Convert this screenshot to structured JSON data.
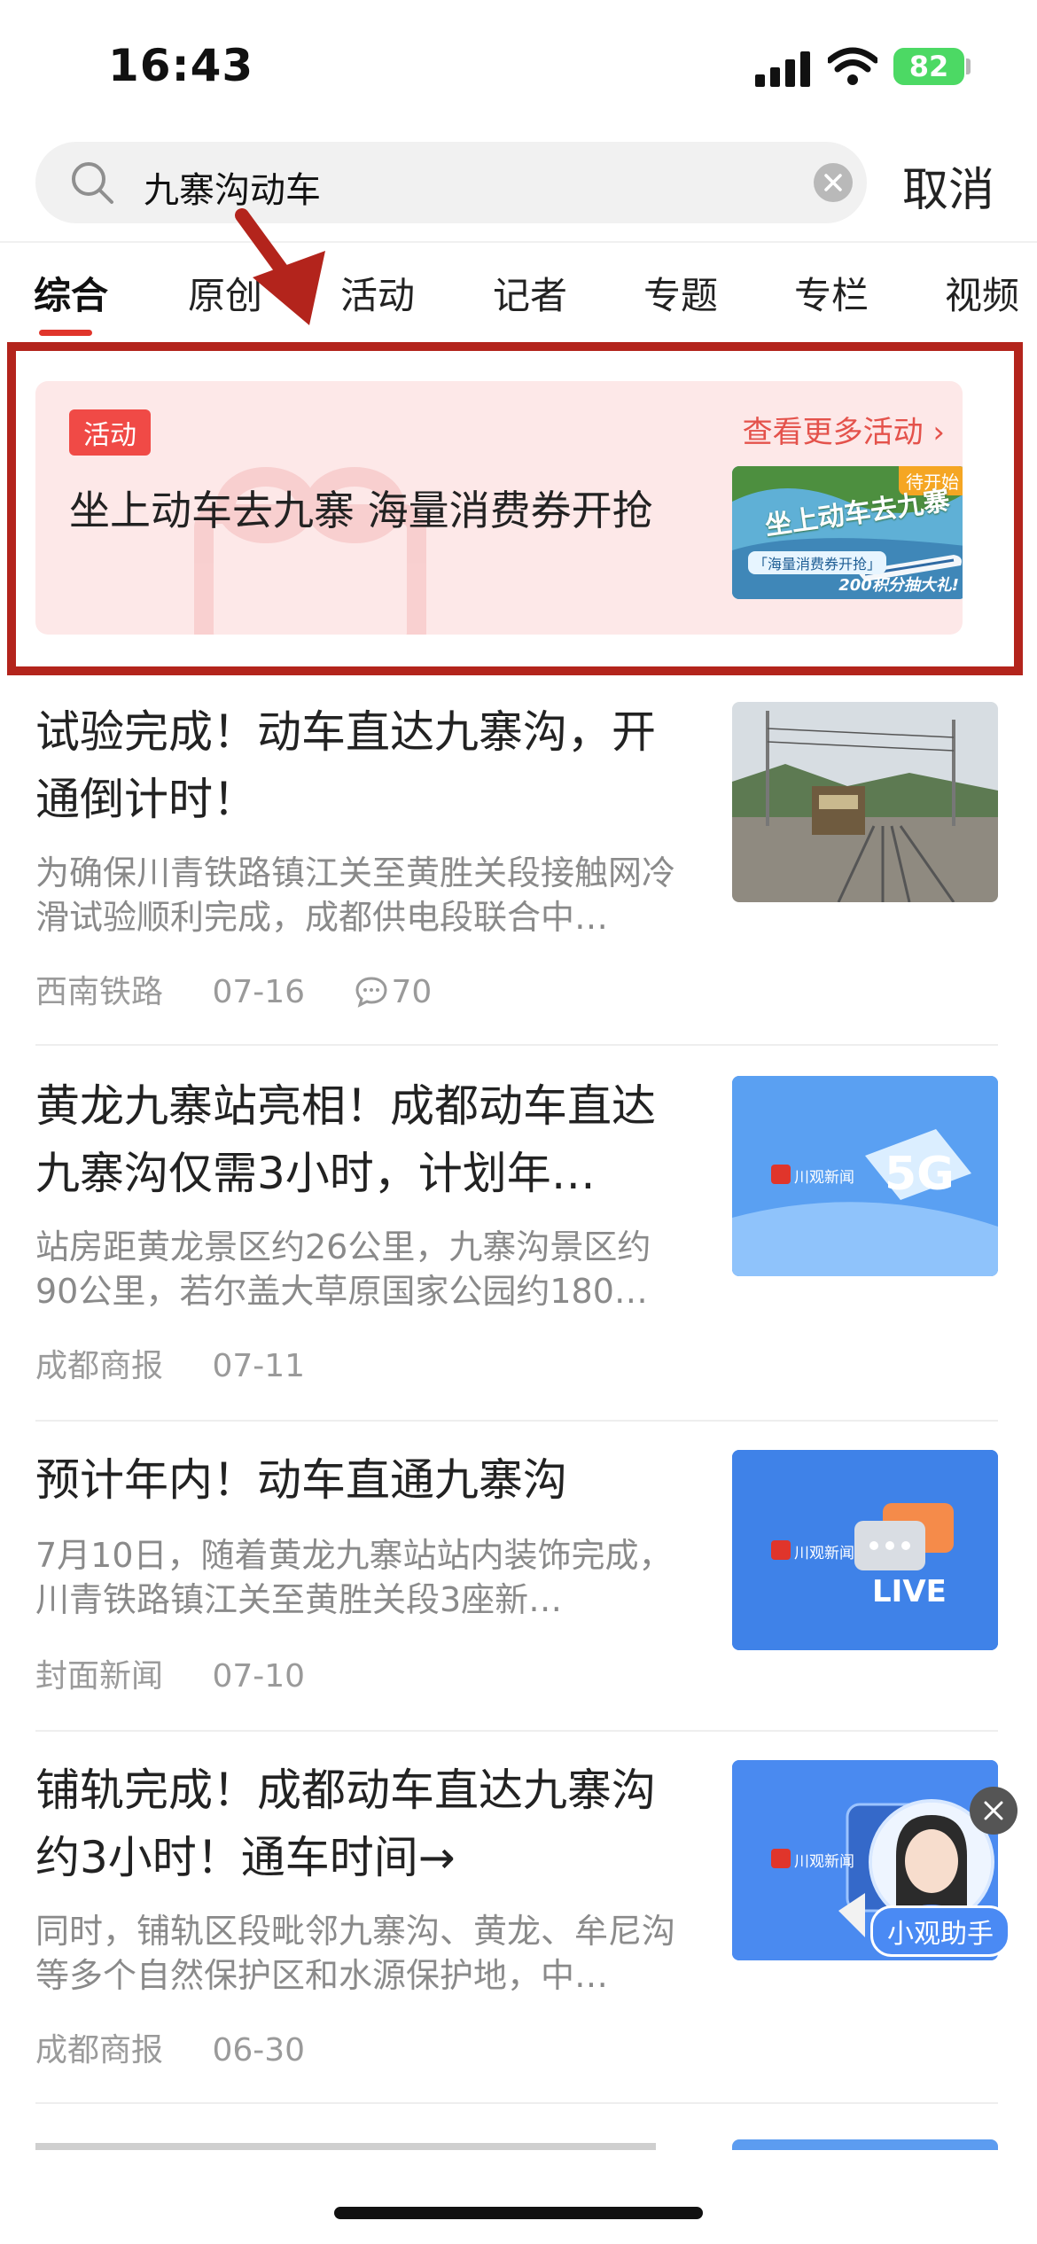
{
  "status_bar": {
    "time": "16:43",
    "battery": "82"
  },
  "search": {
    "query": "九寨沟动车",
    "cancel_label": "取消"
  },
  "tabs": [
    {
      "label": "综合"
    },
    {
      "label": "原创"
    },
    {
      "label": "活动"
    },
    {
      "label": "记者"
    },
    {
      "label": "专题"
    },
    {
      "label": "专栏"
    },
    {
      "label": "视频"
    }
  ],
  "banner": {
    "tag": "活动",
    "more_label": "查看更多活动 ›",
    "title": "坐上动车去九寨  海量消费券开抢",
    "thumb": {
      "badge": "待开始",
      "caption_main": "坐上动车去九寨",
      "caption_sub": "「海量消费券开抢」",
      "caption_bonus": "200积分抽大礼!"
    }
  },
  "news": [
    {
      "title": "试验完成！动车直达九寨沟，开通倒计时！",
      "summary": "为确保川青铁路镇江关至黄胜关段接触网冷滑试验顺利完成，成都供电段联合中…",
      "source": "西南铁路",
      "date": "07-16",
      "comments": "70"
    },
    {
      "title": "黄龙九寨站亮相！成都动车直达九寨沟仅需3小时，计划年…",
      "summary": "站房距黄龙景区约26公里，九寨沟景区约90公里，若尔盖大草原国家公园约180…",
      "source": "成都商报",
      "date": "07-11",
      "thumb_brand": "川观新闻"
    },
    {
      "title": "预计年内！动车直通九寨沟",
      "summary": "7月10日，随着黄龙九寨站站内装饰完成，川青铁路镇江关至黄胜关段3座新…",
      "source": "封面新闻",
      "date": "07-10",
      "thumb_brand": "川观新闻",
      "thumb_label": "LIVE"
    },
    {
      "title": "铺轨完成！成都动车直达九寨沟约3小时！通车时间→",
      "summary": "同时，铺轨区段毗邻九寨沟、黄龙、牟尼沟等多个自然保护区和水源保护地，中…",
      "source": "成都商报",
      "date": "06-30",
      "thumb_brand": "川观新闻"
    }
  ],
  "assistant": {
    "label": "小观助手"
  },
  "colors": {
    "accent": "#e0352b",
    "annotation": "#b3241c",
    "banner_bg": "#fde8e8"
  }
}
